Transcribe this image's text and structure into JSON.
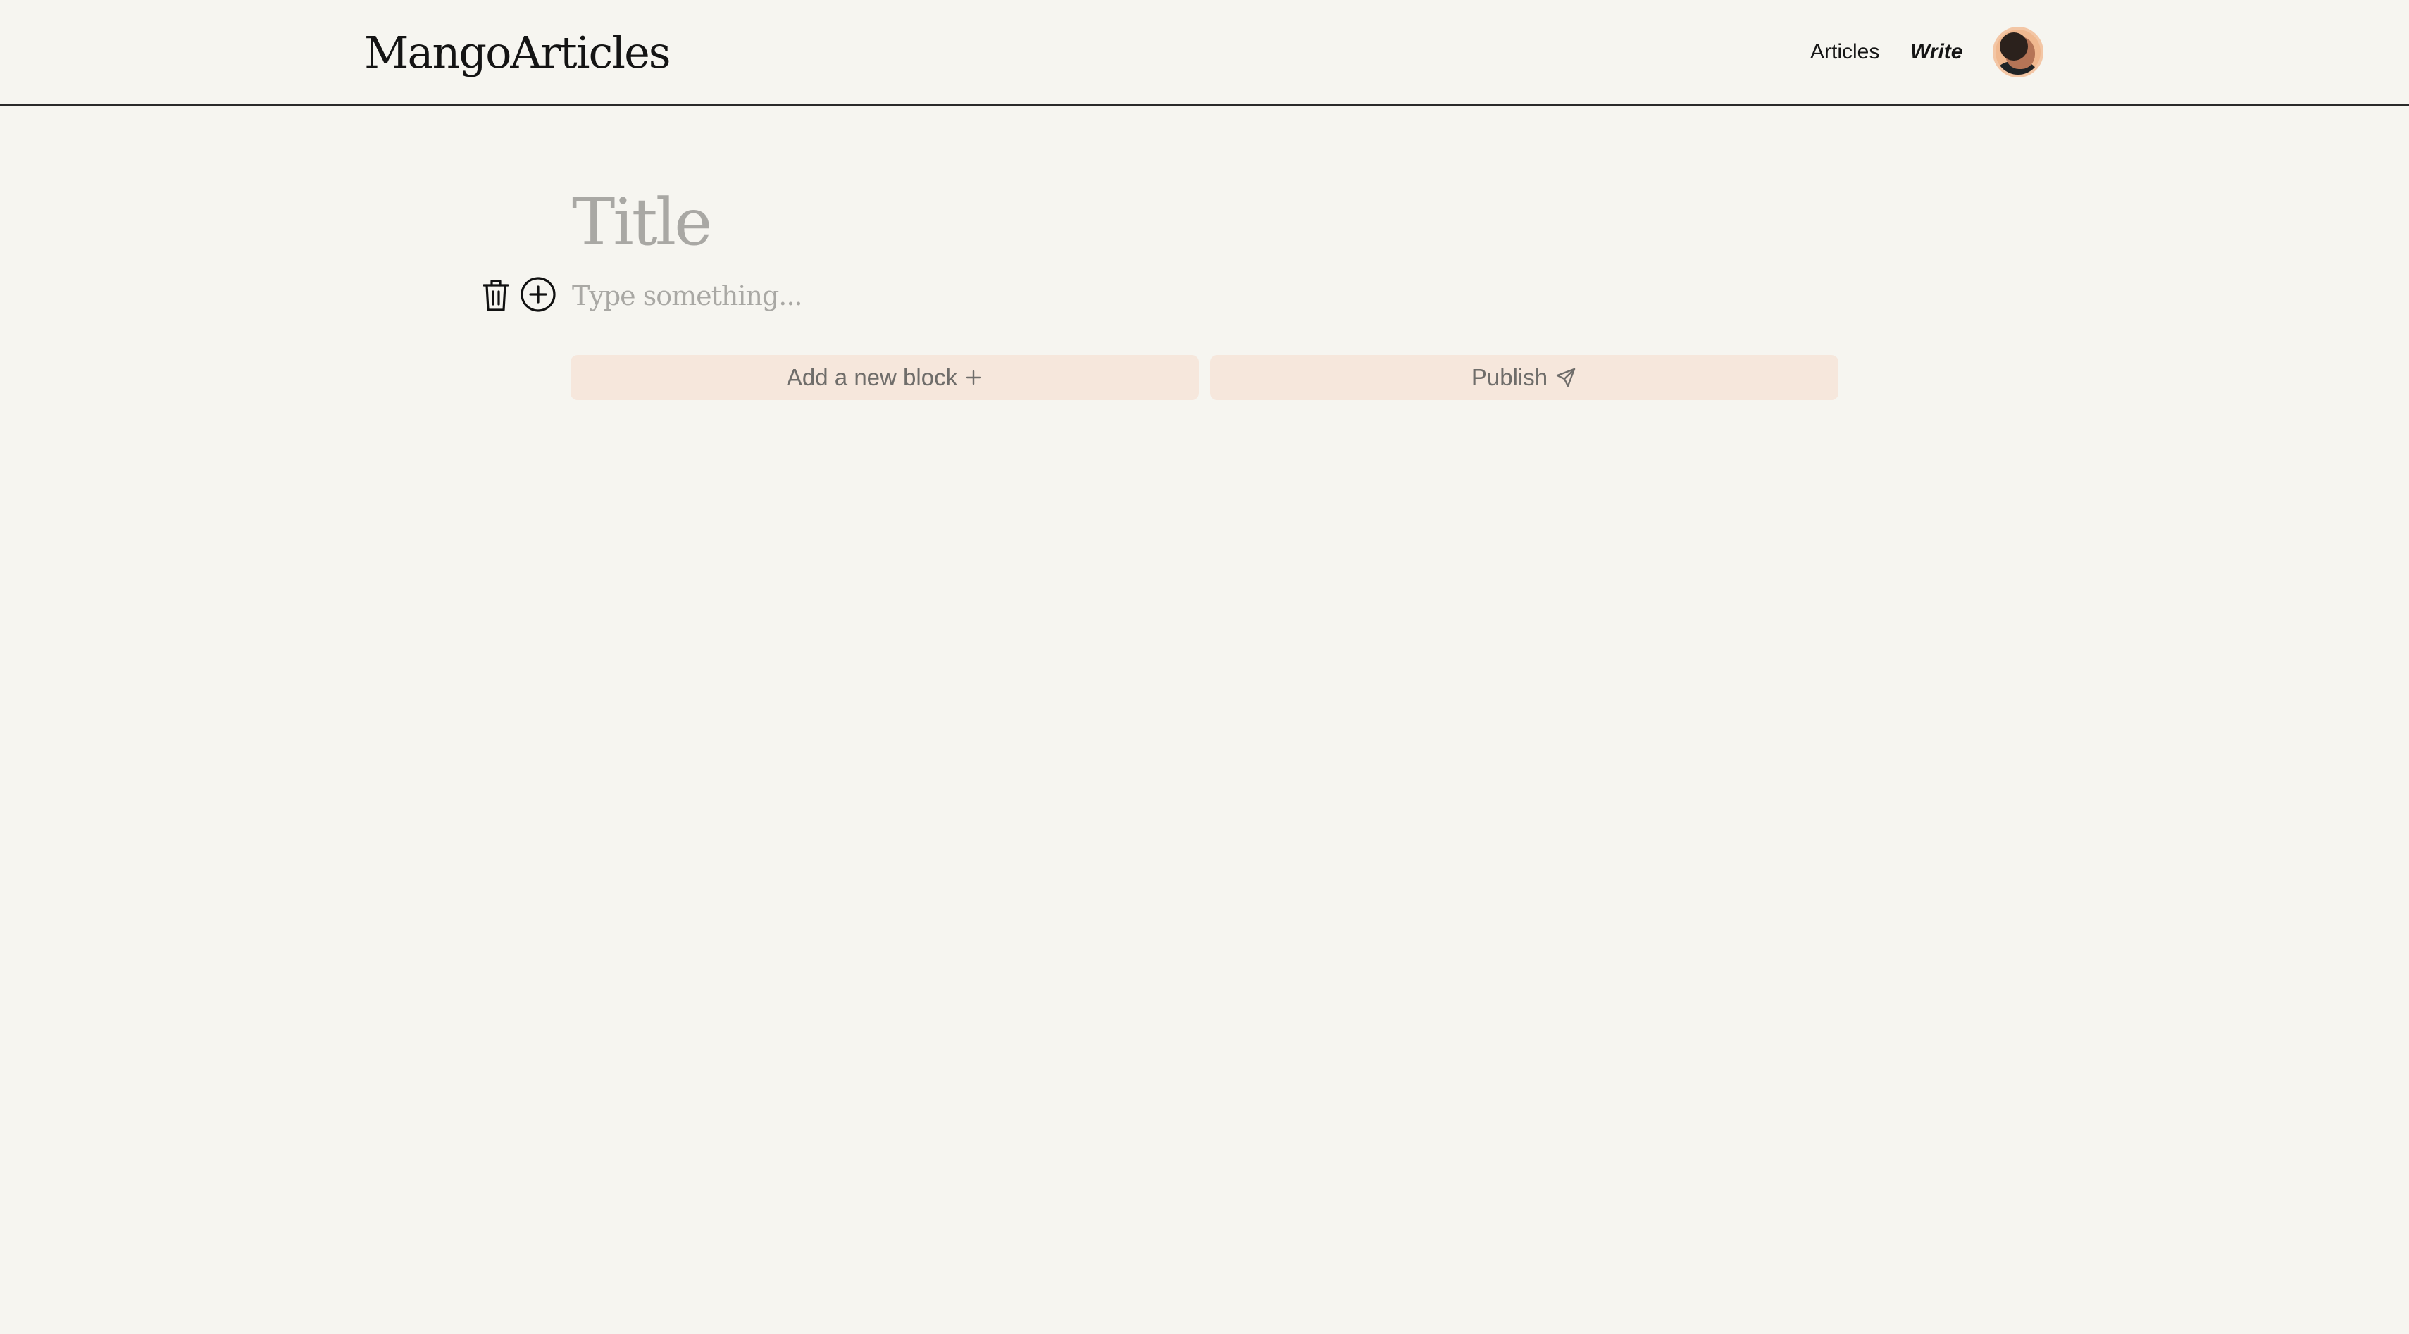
{
  "header": {
    "logo": "MangoArticles",
    "nav": {
      "articles_label": "Articles",
      "write_label": "Write"
    },
    "avatar_icon": "user-avatar"
  },
  "editor": {
    "title_placeholder": "Title",
    "block_placeholder": "Type something...",
    "block_icons": [
      "trash-icon",
      "plus-circle-icon"
    ],
    "add_block_label": "Add a new block",
    "add_block_icon": "plus-icon",
    "publish_label": "Publish",
    "publish_icon": "send-icon"
  },
  "colors": {
    "background": "#f6f5f0",
    "button_bg": "#f6e7dc",
    "button_text": "#6f6d6a",
    "placeholder": "#a9a8a4",
    "text": "#111111"
  }
}
